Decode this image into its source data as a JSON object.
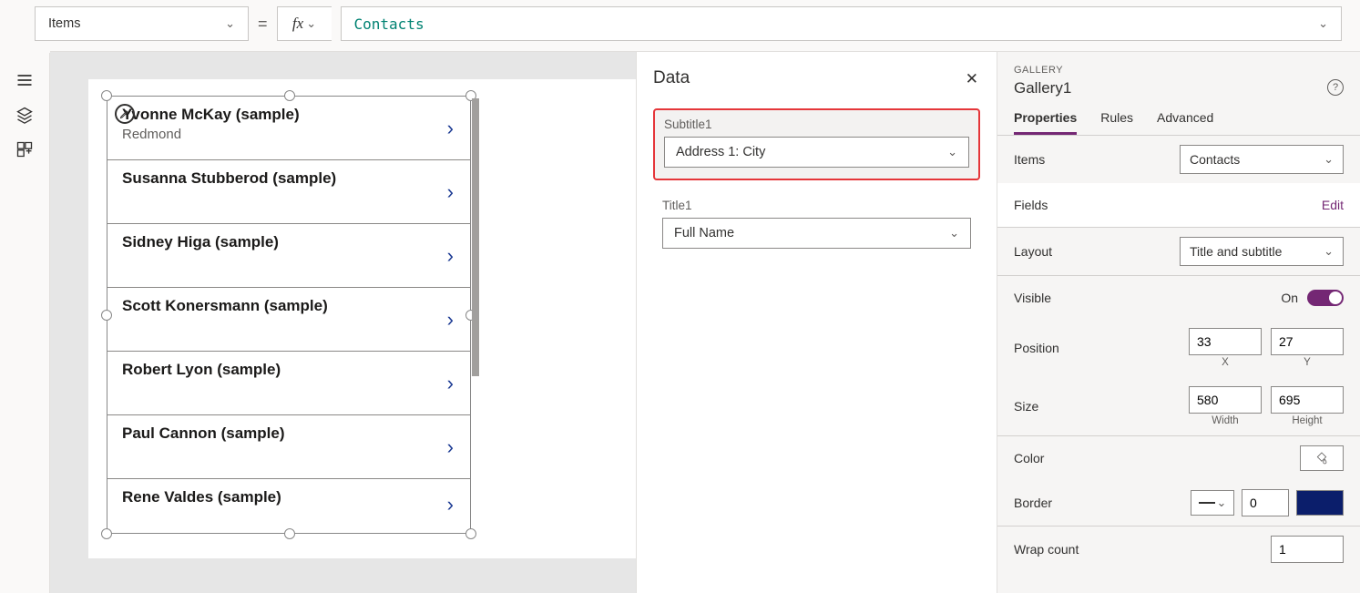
{
  "formulaBar": {
    "property": "Items",
    "formula": "Contacts"
  },
  "gallery": {
    "items": [
      {
        "title": "Yvonne McKay (sample)",
        "subtitle": "Redmond"
      },
      {
        "title": "Susanna Stubberod (sample)",
        "subtitle": ""
      },
      {
        "title": "Sidney Higa (sample)",
        "subtitle": ""
      },
      {
        "title": "Scott Konersmann (sample)",
        "subtitle": ""
      },
      {
        "title": "Robert Lyon (sample)",
        "subtitle": ""
      },
      {
        "title": "Paul Cannon (sample)",
        "subtitle": ""
      },
      {
        "title": "Rene Valdes (sample)",
        "subtitle": ""
      }
    ]
  },
  "dataPanel": {
    "title": "Data",
    "fields": {
      "subtitle": {
        "label": "Subtitle1",
        "value": "Address 1: City"
      },
      "title": {
        "label": "Title1",
        "value": "Full Name"
      }
    }
  },
  "props": {
    "kicker": "GALLERY",
    "name": "Gallery1",
    "tabs": {
      "properties": "Properties",
      "rules": "Rules",
      "advanced": "Advanced"
    },
    "rows": {
      "items": {
        "label": "Items",
        "value": "Contacts"
      },
      "fields": {
        "label": "Fields",
        "link": "Edit"
      },
      "layout": {
        "label": "Layout",
        "value": "Title and subtitle"
      },
      "visible": {
        "label": "Visible",
        "value": "On"
      },
      "position": {
        "label": "Position",
        "x": "33",
        "y": "27",
        "xLabel": "X",
        "yLabel": "Y"
      },
      "size": {
        "label": "Size",
        "w": "580",
        "h": "695",
        "wLabel": "Width",
        "hLabel": "Height"
      },
      "color": {
        "label": "Color"
      },
      "border": {
        "label": "Border",
        "value": "0"
      },
      "wrap": {
        "label": "Wrap count",
        "value": "1"
      }
    }
  }
}
